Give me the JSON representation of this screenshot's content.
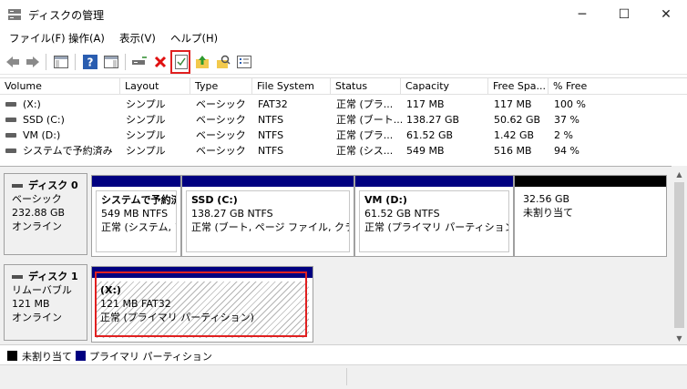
{
  "window": {
    "title": "ディスクの管理",
    "controls": {
      "minimize": "─",
      "maximize": "☐",
      "close": "✕"
    }
  },
  "menu": [
    "ファイル(F)",
    "操作(A)",
    "表示(V)",
    "ヘルプ(H)"
  ],
  "toolbar": {
    "buttons": [
      "back-icon",
      "forward-icon",
      "console-tree-icon",
      "help-icon",
      "action-pane-icon",
      "connect-disk-icon",
      "delete-icon",
      "check-icon",
      "folder-up-icon",
      "search-folder-icon",
      "properties-icon"
    ]
  },
  "volume_list": {
    "columns": [
      "Volume",
      "Layout",
      "Type",
      "File System",
      "Status",
      "Capacity",
      "Free Spa...",
      "% Free"
    ],
    "rows": [
      {
        "volume": "(X:)",
        "layout": "シンプル",
        "type": "ベーシック",
        "fs": "FAT32",
        "status": "正常 (プラ...",
        "capacity": "117 MB",
        "free": "117 MB",
        "pct": "100 %"
      },
      {
        "volume": "SSD (C:)",
        "layout": "シンプル",
        "type": "ベーシック",
        "fs": "NTFS",
        "status": "正常 (ブート...",
        "capacity": "138.27 GB",
        "free": "50.62 GB",
        "pct": "37 %"
      },
      {
        "volume": "VM (D:)",
        "layout": "シンプル",
        "type": "ベーシック",
        "fs": "NTFS",
        "status": "正常 (プラ...",
        "capacity": "61.52 GB",
        "free": "1.42 GB",
        "pct": "2 %"
      },
      {
        "volume": "システムで予約済み",
        "layout": "シンプル",
        "type": "ベーシック",
        "fs": "NTFS",
        "status": "正常 (シス...",
        "capacity": "549 MB",
        "free": "516 MB",
        "pct": "94 %"
      }
    ]
  },
  "disks": [
    {
      "name": "ディスク 0",
      "type": "ベーシック",
      "size": "232.88 GB",
      "state": "オンライン",
      "partitions": [
        {
          "name": "システムで予約済",
          "info": "549 MB NTFS",
          "status": "正常 (システム, ア"
        },
        {
          "name": "SSD  (C:)",
          "info": "138.27 GB NTFS",
          "status": "正常 (ブート, ページ ファイル, クラッシュ"
        },
        {
          "name": "VM  (D:)",
          "info": "61.52 GB NTFS",
          "status": "正常 (プライマリ パーティション)"
        },
        {
          "name": "",
          "info": "32.56 GB",
          "status": "未割り当て"
        }
      ]
    },
    {
      "name": "ディスク 1",
      "type": "リムーバブル",
      "size": "121 MB",
      "state": "オンライン",
      "partitions": [
        {
          "name": "(X:)",
          "info": "121 MB FAT32",
          "status": "正常 (プライマリ パーティション)"
        }
      ]
    }
  ],
  "legend": {
    "unallocated": "未割り当て",
    "primary": "プライマリ パーティション",
    "colors": {
      "unallocated": "#000000",
      "primary": "#000080"
    }
  }
}
